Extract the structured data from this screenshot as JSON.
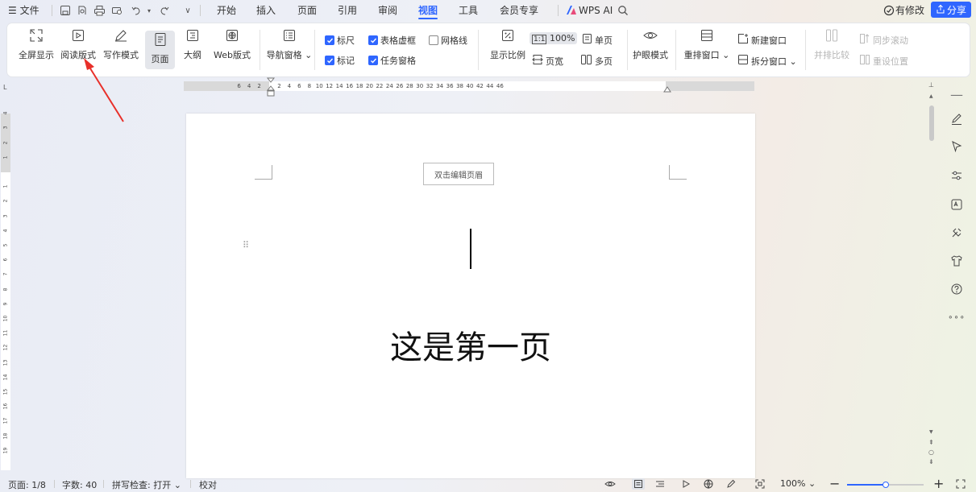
{
  "menubar": {
    "file_label": "文件",
    "tabs": [
      "开始",
      "插入",
      "页面",
      "引用",
      "审阅",
      "视图",
      "工具",
      "会员专享"
    ],
    "active_tab": "视图",
    "wps_ai_label": "WPS AI",
    "modified_label": "有修改",
    "share_label": "分享"
  },
  "ribbon": {
    "fullscreen": "全屏显示",
    "reading_layout": "阅读版式",
    "writing_mode": "写作模式",
    "page_view": "页面",
    "outline": "大纲",
    "web_layout": "Web版式",
    "nav_pane": "导航窗格",
    "ruler": "标尺",
    "table_gridlines": "表格虚框",
    "gridlines": "网格线",
    "markup": "标记",
    "task_pane": "任务窗格",
    "zoom": "显示比例",
    "zoom_100": "100%",
    "page_width": "页宽",
    "single_page": "单页",
    "multi_page": "多页",
    "eye_mode": "护眼模式",
    "arrange_window": "重排窗口",
    "new_window": "新建窗口",
    "split_window": "拆分窗口",
    "side_by_side": "并排比较",
    "sync_scroll": "同步滚动",
    "reset_position": "重设位置",
    "checks": {
      "ruler": true,
      "table_gridlines": true,
      "gridlines": false,
      "markup": true,
      "task_pane": true
    }
  },
  "ruler": {
    "h_ticks": [
      "6",
      "4",
      "2",
      "2",
      "4",
      "6",
      "8",
      "10",
      "12",
      "14",
      "16",
      "18",
      "20",
      "22",
      "24",
      "26",
      "28",
      "30",
      "32",
      "34",
      "36",
      "38",
      "40",
      "42",
      "44",
      "46"
    ],
    "v_ticks": [
      "4",
      "3",
      "2",
      "1",
      "1",
      "2",
      "3",
      "4",
      "5",
      "6",
      "7",
      "8",
      "9",
      "10",
      "11",
      "12",
      "13",
      "14",
      "15",
      "16",
      "17",
      "18",
      "19"
    ]
  },
  "document": {
    "header_tip": "双击编辑页眉",
    "body_text": "这是第一页"
  },
  "statusbar": {
    "page": "页面: 1/8",
    "word_count": "字数: 40",
    "spell_check": "拼写检查: 打开",
    "proofread": "校对",
    "zoom": "100%",
    "zoom_fraction": 0.5
  },
  "colors": {
    "accent": "#2f66ff",
    "annotation_arrow": "#e8302a"
  }
}
